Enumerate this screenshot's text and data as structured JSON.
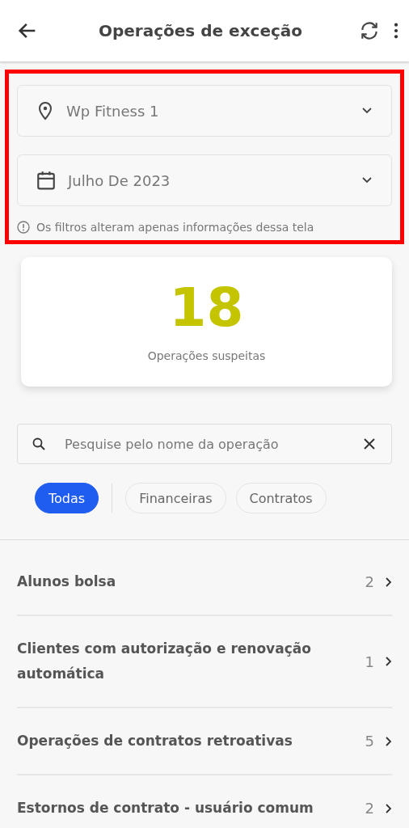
{
  "header": {
    "title": "Operações de exceção"
  },
  "filters": {
    "highlighted": true,
    "fields": [
      {
        "kind": "location",
        "value": "Wp Fitness 1"
      },
      {
        "kind": "date",
        "value": "Julho De 2023"
      }
    ],
    "note": "Os filtros alteram apenas informações dessa tela"
  },
  "summary": {
    "count": "18",
    "label": "Operações suspeitas"
  },
  "search": {
    "placeholder": "Pesquise pelo nome da operação"
  },
  "chips": [
    {
      "label": "Todas",
      "selected": true
    },
    {
      "label": "Financeiras",
      "selected": false
    },
    {
      "label": "Contratos",
      "selected": false
    }
  ],
  "operations": [
    {
      "name": "Alunos bolsa",
      "count": "2"
    },
    {
      "name": "Clientes com autorização e renovação automática",
      "count": "1"
    },
    {
      "name": "Operações de contratos retroativas",
      "count": "5"
    },
    {
      "name": "Estornos de contrato - usuário comum",
      "count": "2"
    }
  ]
}
